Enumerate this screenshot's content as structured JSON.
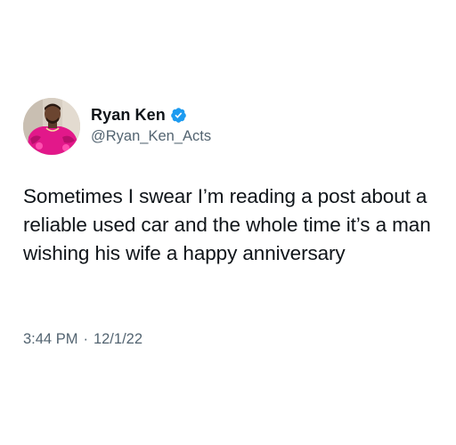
{
  "author": {
    "display_name": "Ryan Ken",
    "handle": "@Ryan_Ken_Acts",
    "verified": true,
    "avatar": "profile-photo",
    "verified_color": "#1d9bf0"
  },
  "tweet": {
    "text": "Sometimes I swear I’m reading a post about a reliable used car and the whole time it’s a man wishing his wife a happy anniversary",
    "time": "3:44 PM",
    "separator": "·",
    "date": "12/1/22"
  },
  "colors": {
    "text_primary": "#0f1419",
    "text_secondary": "#536471",
    "background": "#ffffff"
  }
}
